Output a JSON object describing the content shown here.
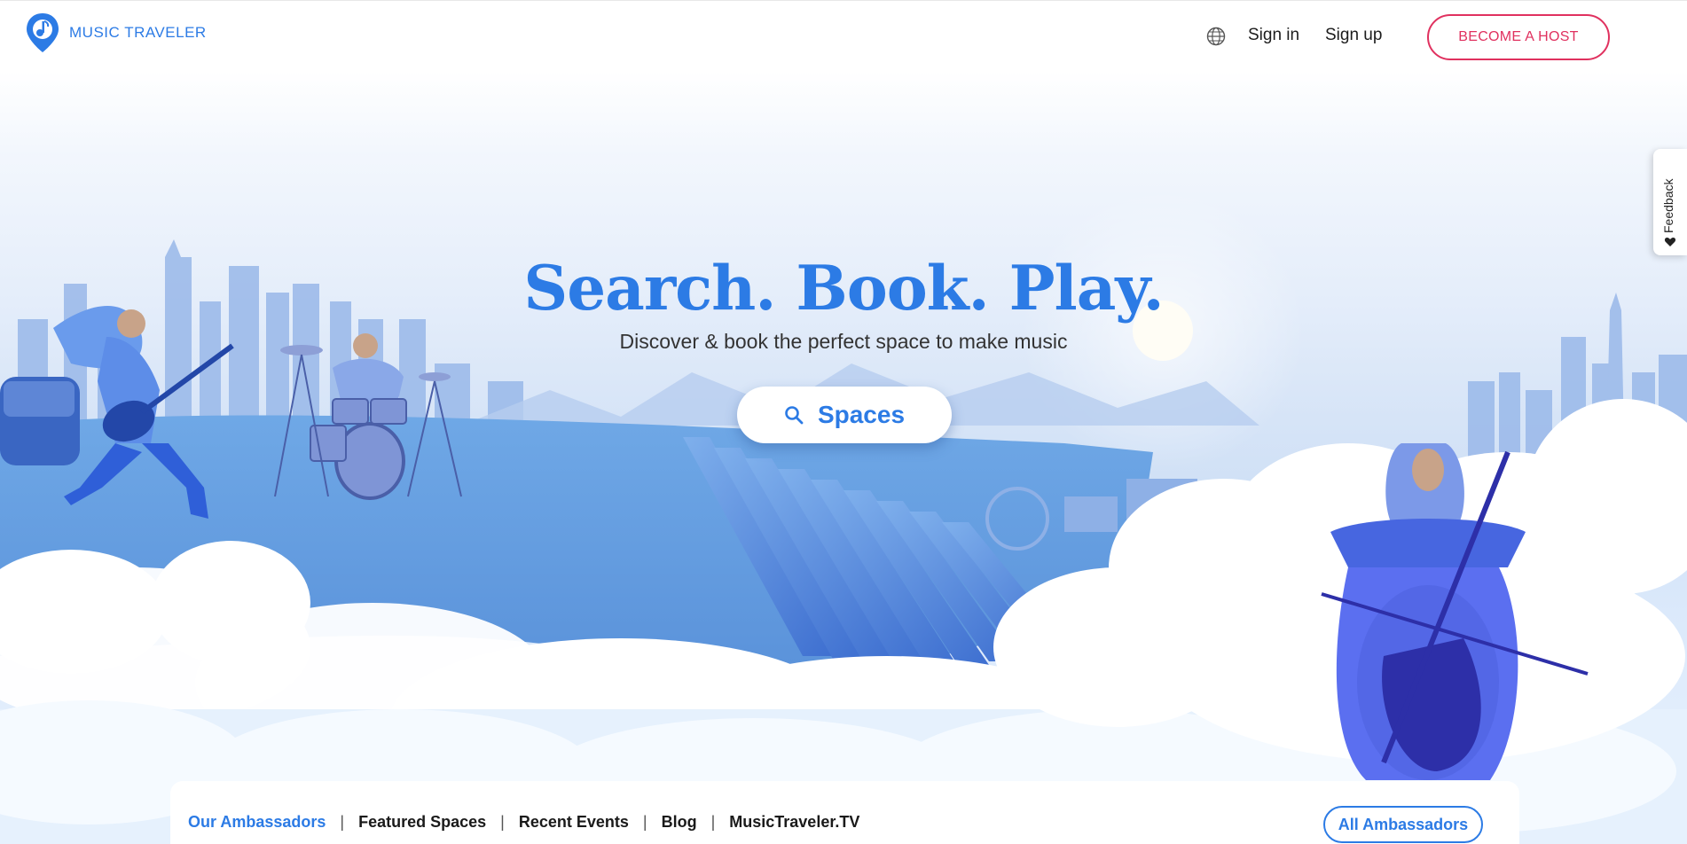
{
  "header": {
    "logo_text": "MUSIC TRAVELER",
    "globe_icon": "globe-icon",
    "sign_in": "Sign in",
    "sign_up": "Sign up",
    "become_host": "BECOME A HOST"
  },
  "hero": {
    "title": "Search. Book. Play.",
    "subtitle": "Discover & book the perfect space to make music",
    "search_button": "Spaces",
    "search_icon": "search-icon"
  },
  "feedback": {
    "label": "Feedback",
    "icon": "heart-icon"
  },
  "tabs": {
    "items": [
      {
        "label": "Our Ambassadors",
        "active": true
      },
      {
        "label": "Featured Spaces",
        "active": false
      },
      {
        "label": "Recent Events",
        "active": false
      },
      {
        "label": "Blog",
        "active": false
      },
      {
        "label": "MusicTraveler.TV",
        "active": false
      }
    ],
    "separator": "|",
    "all_button": "All Ambassadors"
  },
  "colors": {
    "brand_blue": "#2c7be5",
    "host_pink": "#e0315f"
  }
}
